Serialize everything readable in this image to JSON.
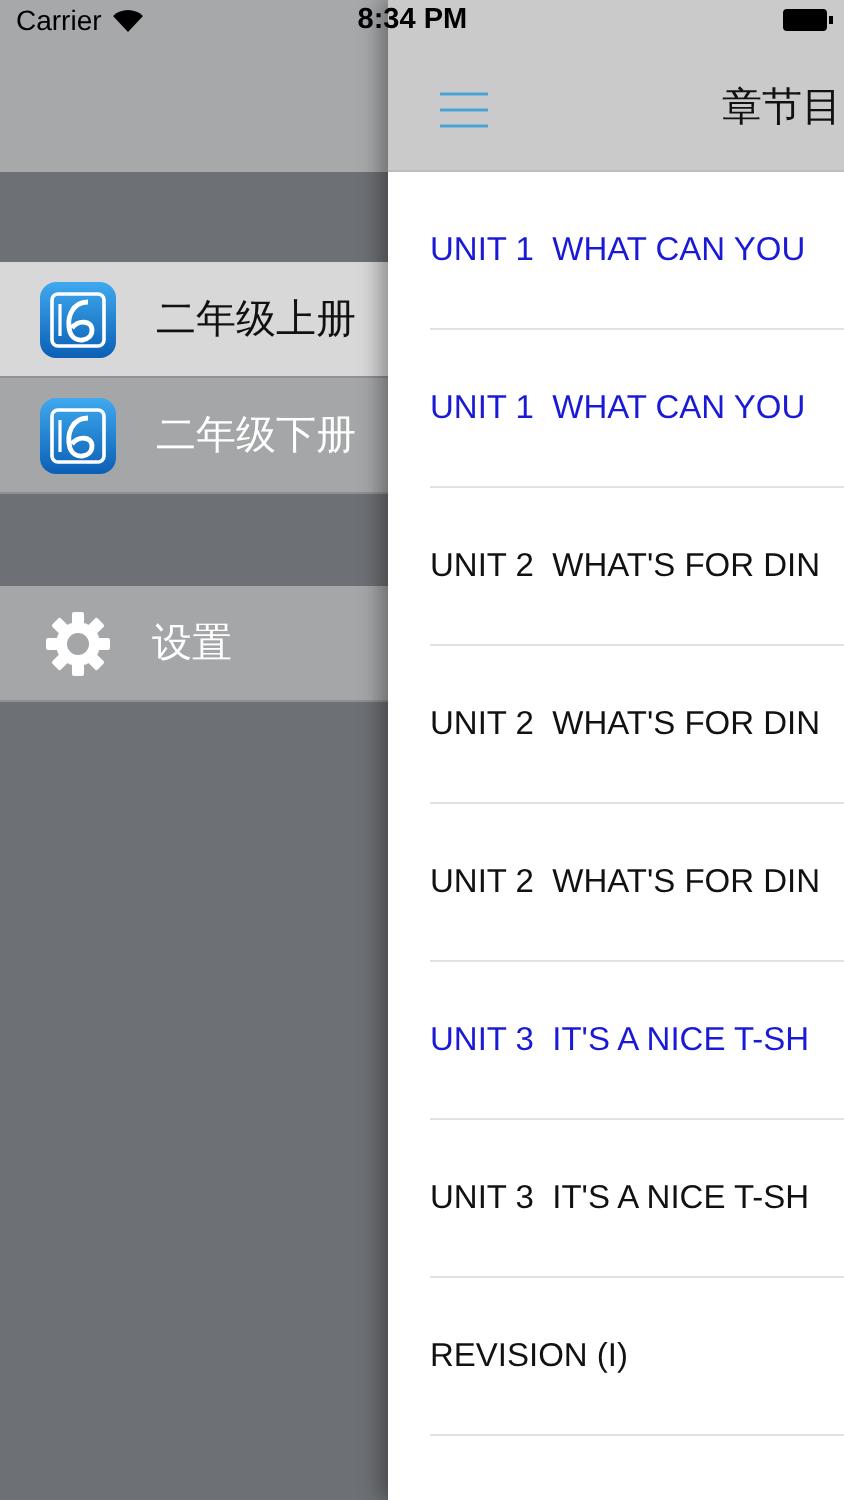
{
  "status_bar": {
    "carrier": "Carrier",
    "time": "8:34 PM"
  },
  "drawer": {
    "books": [
      {
        "label": "二年级上册",
        "selected": true
      },
      {
        "label": "二年级下册",
        "selected": false
      }
    ],
    "settings": {
      "label": "设置"
    }
  },
  "main": {
    "title": "章节目",
    "chapters": [
      {
        "label": "UNIT 1  WHAT CAN YOU",
        "highlighted": true
      },
      {
        "label": "UNIT 1  WHAT CAN YOU",
        "highlighted": true
      },
      {
        "label": "UNIT 2  WHAT'S FOR DIN",
        "highlighted": false
      },
      {
        "label": "UNIT 2  WHAT'S FOR DIN",
        "highlighted": false
      },
      {
        "label": "UNIT 2  WHAT'S FOR DIN",
        "highlighted": false
      },
      {
        "label": "UNIT 3  IT'S A NICE T-SH",
        "highlighted": true
      },
      {
        "label": "UNIT 3  IT'S A NICE T-SH",
        "highlighted": false
      },
      {
        "label": "REVISION (I)",
        "highlighted": false
      }
    ]
  }
}
